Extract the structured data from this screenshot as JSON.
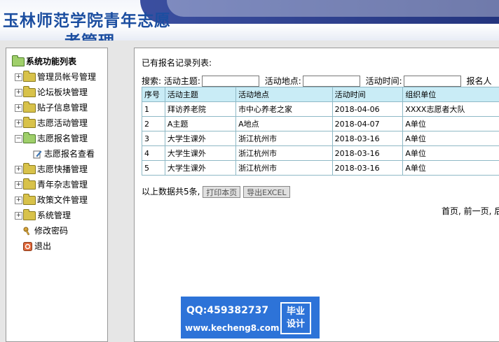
{
  "header": {
    "title_line1": "玉林师范学院青年志愿",
    "title_line2": "者管理"
  },
  "sidebar": {
    "root": {
      "label": "系统功能列表",
      "icon": "folder-open-icon"
    },
    "items": [
      {
        "label": "管理员帐号管理",
        "icon": "folder-icon",
        "expander": "+"
      },
      {
        "label": "论坛板块管理",
        "icon": "folder-icon",
        "expander": "+"
      },
      {
        "label": "贴子信息管理",
        "icon": "folder-icon",
        "expander": "+"
      },
      {
        "label": "志愿活动管理",
        "icon": "folder-icon",
        "expander": "+"
      },
      {
        "label": "志愿报名管理",
        "icon": "folder-open-icon",
        "expander": "-"
      },
      {
        "label": "志愿报名查看",
        "icon": "edit-icon",
        "expander": ""
      },
      {
        "label": "志愿快播管理",
        "icon": "folder-icon",
        "expander": "+"
      },
      {
        "label": "青年杂志管理",
        "icon": "folder-icon",
        "expander": "+"
      },
      {
        "label": "政策文件管理",
        "icon": "folder-icon",
        "expander": "+"
      },
      {
        "label": "系统管理",
        "icon": "folder-icon",
        "expander": "+"
      },
      {
        "label": "修改密码",
        "icon": "key-icon",
        "expander": ""
      },
      {
        "label": "退出",
        "icon": "exit-icon",
        "expander": ""
      }
    ]
  },
  "main": {
    "list_title": "已有报名记录列表:",
    "search": {
      "prefix": "搜索:",
      "topic_label": "活动主题:",
      "place_label": "活动地点:",
      "time_label": "活动时间:",
      "extra_label": "报名人"
    },
    "table": {
      "columns": [
        "序号",
        "活动主题",
        "活动地点",
        "活动时间",
        "组织单位"
      ],
      "rows": [
        [
          "1",
          "拜访养老院",
          "市中心养老之家",
          "2018-04-06",
          "XXXX志愿者大队"
        ],
        [
          "2",
          "A主题",
          "A地点",
          "2018-04-07",
          "A单位"
        ],
        [
          "3",
          "大学生课外",
          "浙江杭州市",
          "2018-03-16",
          "A单位"
        ],
        [
          "4",
          "大学生课外",
          "浙江杭州市",
          "2018-03-16",
          "A单位"
        ],
        [
          "5",
          "大学生课外",
          "浙江杭州市",
          "2018-03-16",
          "A单位"
        ]
      ]
    },
    "summary": "以上数据共5条,",
    "print_button": "打印本页",
    "export_button": "导出EXCEL",
    "pager": "首页, 前一页, 后"
  },
  "watermark": {
    "qq": "QQ:459382737",
    "url": "www.kecheng8.com",
    "badge_line1": "毕业",
    "badge_line2": "设计"
  },
  "colors": {
    "header_text": "#1c4ea0",
    "table_header_bg": "#c9ecf6",
    "watermark_bg": "#2d73d8"
  }
}
